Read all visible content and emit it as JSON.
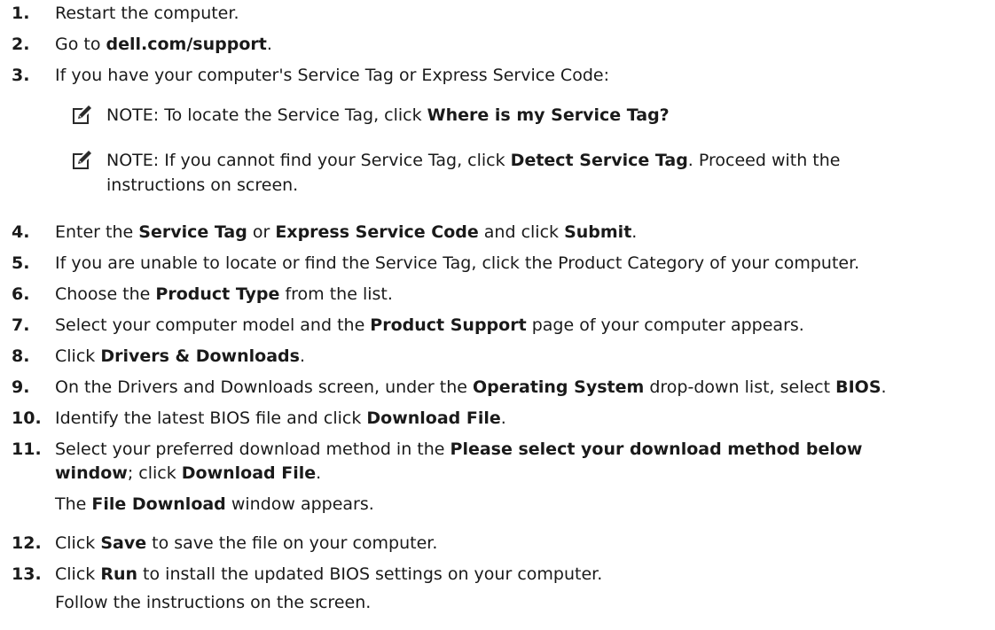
{
  "steps": [
    {
      "num": "1.",
      "parts": [
        {
          "t": "Restart the computer."
        }
      ]
    },
    {
      "num": "2.",
      "parts": [
        {
          "t": "Go to "
        },
        {
          "t": "dell.com/support",
          "b": true
        },
        {
          "t": "."
        }
      ]
    },
    {
      "num": "3.",
      "parts": [
        {
          "t": "If you have your computer's Service Tag or Express Service Code:"
        }
      ]
    },
    {
      "num": "4.",
      "parts": [
        {
          "t": "Enter the "
        },
        {
          "t": "Service Tag",
          "b": true
        },
        {
          "t": " or "
        },
        {
          "t": "Express Service Code",
          "b": true
        },
        {
          "t": " and click "
        },
        {
          "t": "Submit",
          "b": true
        },
        {
          "t": "."
        }
      ]
    },
    {
      "num": "5.",
      "parts": [
        {
          "t": "If you are unable to locate or find the Service Tag, click the Product Category of your computer."
        }
      ]
    },
    {
      "num": "6.",
      "parts": [
        {
          "t": "Choose the "
        },
        {
          "t": "Product Type",
          "b": true
        },
        {
          "t": " from the list."
        }
      ]
    },
    {
      "num": "7.",
      "parts": [
        {
          "t": "Select your computer model and the "
        },
        {
          "t": "Product Support",
          "b": true
        },
        {
          "t": " page of your computer appears."
        }
      ]
    },
    {
      "num": "8.",
      "parts": [
        {
          "t": "Click "
        },
        {
          "t": "Drivers & Downloads",
          "b": true
        },
        {
          "t": "."
        }
      ]
    },
    {
      "num": "9.",
      "parts": [
        {
          "t": "On the Drivers and Downloads screen, under the "
        },
        {
          "t": "Operating System",
          "b": true
        },
        {
          "t": " drop-down list, select "
        },
        {
          "t": "BIOS",
          "b": true
        },
        {
          "t": "."
        }
      ]
    },
    {
      "num": "10.",
      "parts": [
        {
          "t": "Identify the latest BIOS file and click "
        },
        {
          "t": "Download File",
          "b": true
        },
        {
          "t": "."
        }
      ]
    },
    {
      "num": "11.",
      "parts": [
        {
          "t": "Select your preferred download method in the "
        },
        {
          "t": "Please select your download method below",
          "b": true
        }
      ]
    },
    {
      "num": "12.",
      "parts": [
        {
          "t": "Click "
        },
        {
          "t": "Save",
          "b": true
        },
        {
          "t": " to save the file on your computer."
        }
      ]
    },
    {
      "num": "13.",
      "parts": [
        {
          "t": "Click "
        },
        {
          "t": "Run",
          "b": true
        },
        {
          "t": " to install the updated BIOS settings on your computer."
        }
      ]
    }
  ],
  "step11_cont": [
    {
      "t": "window",
      "b": true
    },
    {
      "t": "; click "
    },
    {
      "t": "Download File",
      "b": true
    },
    {
      "t": "."
    }
  ],
  "step11_extra": [
    {
      "t": "The "
    },
    {
      "t": "File Download",
      "b": true
    },
    {
      "t": " window appears."
    }
  ],
  "step13_extra": [
    {
      "t": "Follow the instructions on the screen."
    }
  ],
  "notes": [
    {
      "label": "NOTE:",
      "parts": [
        {
          "t": " To locate the Service Tag, click "
        },
        {
          "t": "Where is my Service Tag?",
          "b": true
        }
      ]
    },
    {
      "label": "NOTE:",
      "parts": [
        {
          "t": " If you cannot find your Service Tag, click "
        },
        {
          "t": "Detect Service Tag",
          "b": true
        },
        {
          "t": ". Proceed with the"
        }
      ],
      "cont": [
        {
          "t": "instructions on screen."
        }
      ]
    }
  ],
  "icon": {
    "name": "note-pencil-icon",
    "color": "#1a1a1a"
  }
}
